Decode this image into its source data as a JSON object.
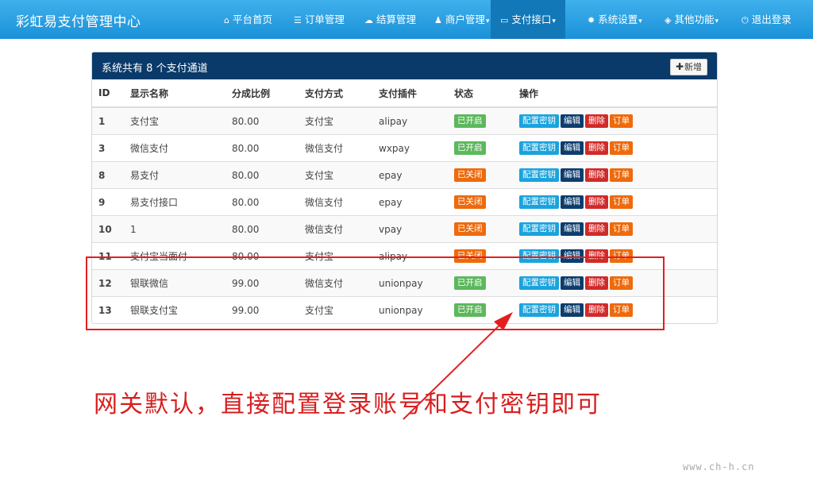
{
  "brand": "彩虹易支付管理中心",
  "nav": [
    {
      "id": "home",
      "label": "平台首页",
      "icon": "home-icon",
      "glyph": "⌂",
      "caret": false,
      "active": false
    },
    {
      "id": "orders",
      "label": "订单管理",
      "icon": "list-icon",
      "glyph": "☰",
      "caret": false,
      "active": false
    },
    {
      "id": "settle",
      "label": "结算管理",
      "icon": "cloud-icon",
      "glyph": "☁",
      "caret": false,
      "active": false
    },
    {
      "id": "merchant",
      "label": "商户管理",
      "icon": "user-icon",
      "glyph": "♟",
      "caret": true,
      "active": false
    },
    {
      "id": "payapi",
      "label": "支付接口",
      "icon": "card-icon",
      "glyph": "▭",
      "caret": true,
      "active": true
    },
    {
      "id": "system",
      "label": "系统设置",
      "icon": "gear-icon",
      "glyph": "✹",
      "caret": true,
      "active": false
    },
    {
      "id": "other",
      "label": "其他功能",
      "icon": "cube-icon",
      "glyph": "◈",
      "caret": true,
      "active": false
    },
    {
      "id": "logout",
      "label": "退出登录",
      "icon": "power-icon",
      "glyph": "⏻",
      "caret": false,
      "active": false
    }
  ],
  "panel": {
    "title_prefix": "系统共有",
    "count": "8",
    "title_suffix": "个支付通道",
    "add_label": "新增"
  },
  "columns": [
    "ID",
    "显示名称",
    "分成比例",
    "支付方式",
    "支付插件",
    "状态",
    "操作"
  ],
  "rows": [
    {
      "id": "1",
      "name": "支付宝",
      "rate": "80.00",
      "method": "支付宝",
      "plugin": "alipay",
      "status": "已开启",
      "on": true
    },
    {
      "id": "3",
      "name": "微信支付",
      "rate": "80.00",
      "method": "微信支付",
      "plugin": "wxpay",
      "status": "已开启",
      "on": true
    },
    {
      "id": "8",
      "name": "易支付",
      "rate": "80.00",
      "method": "支付宝",
      "plugin": "epay",
      "status": "已关闭",
      "on": false
    },
    {
      "id": "9",
      "name": "易支付接口",
      "rate": "80.00",
      "method": "微信支付",
      "plugin": "epay",
      "status": "已关闭",
      "on": false
    },
    {
      "id": "10",
      "name": "1",
      "rate": "80.00",
      "method": "微信支付",
      "plugin": "vpay",
      "status": "已关闭",
      "on": false
    },
    {
      "id": "11",
      "name": "支付宝当面付",
      "rate": "80.00",
      "method": "支付宝",
      "plugin": "alipay",
      "status": "已关闭",
      "on": false
    },
    {
      "id": "12",
      "name": "银联微信",
      "rate": "99.00",
      "method": "微信支付",
      "plugin": "unionpay",
      "status": "已开启",
      "on": true
    },
    {
      "id": "13",
      "name": "银联支付宝",
      "rate": "99.00",
      "method": "支付宝",
      "plugin": "unionpay",
      "status": "已开启",
      "on": true
    }
  ],
  "actions": {
    "config": "配置密钥",
    "edit": "编辑",
    "delete": "删除",
    "order": "订单"
  },
  "annotation": "网关默认，直接配置登录账号和支付密钥即可",
  "watermark": "www.ch-h.cn",
  "colors": {
    "nav": "#1a91d8",
    "header": "#0a3a6a",
    "on": "#5cb85c",
    "off": "#ee6a0c",
    "config": "#1aa3dd",
    "edit": "#0c3d6e",
    "delete": "#d12a2a",
    "order": "#ee6a0c",
    "highlight": "#e41e1e"
  }
}
